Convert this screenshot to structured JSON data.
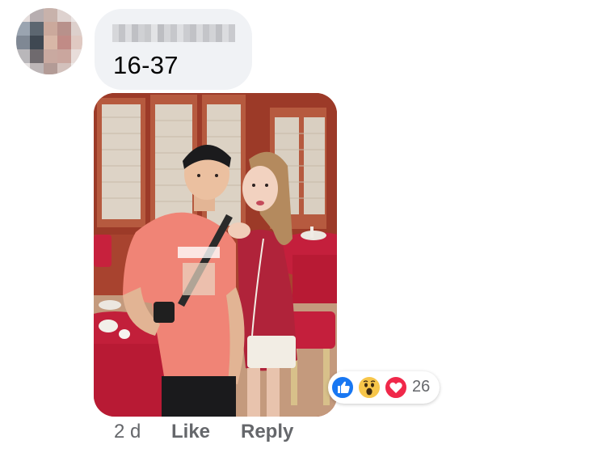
{
  "comment": {
    "author_name_visible": false,
    "text": "16-37",
    "timestamp": "2 d"
  },
  "actions": {
    "like_label": "Like",
    "reply_label": "Reply"
  },
  "reactions": {
    "types": [
      "like-icon",
      "wow-icon",
      "love-icon"
    ],
    "count": "26"
  },
  "colors": {
    "bubble_bg": "#f0f2f5",
    "meta_text": "#65676b",
    "like_blue": "#1877f2",
    "love_red": "#f0284a",
    "wow_yellow": "#f7c64a"
  }
}
